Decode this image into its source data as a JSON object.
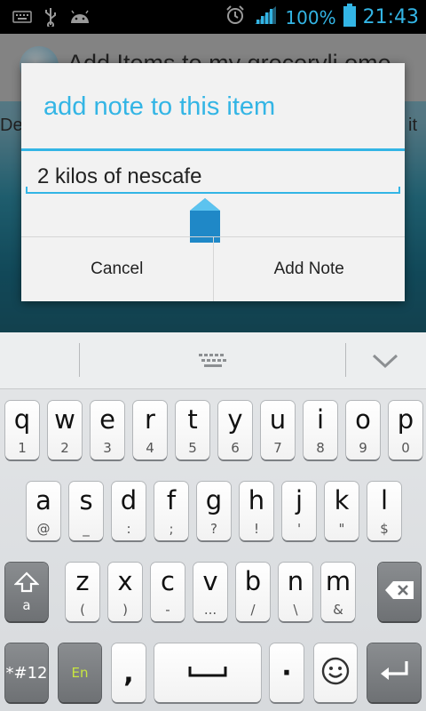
{
  "status_bar": {
    "battery_percent": "100%",
    "time": "21:43"
  },
  "background_app": {
    "title": "Add Items to my groceryli ome",
    "left_label_fragment": "De",
    "right_label_fragment": "it"
  },
  "dialog": {
    "title": "add note to this item",
    "input_value": "2 kilos of nescafe",
    "cancel_label": "Cancel",
    "add_note_label": "Add Note"
  },
  "keyboard": {
    "row1": [
      {
        "main": "q",
        "sub": "1"
      },
      {
        "main": "w",
        "sub": "2"
      },
      {
        "main": "e",
        "sub": "3"
      },
      {
        "main": "r",
        "sub": "4"
      },
      {
        "main": "t",
        "sub": "5"
      },
      {
        "main": "y",
        "sub": "6"
      },
      {
        "main": "u",
        "sub": "7"
      },
      {
        "main": "i",
        "sub": "8"
      },
      {
        "main": "o",
        "sub": "9"
      },
      {
        "main": "p",
        "sub": "0"
      }
    ],
    "row2": [
      {
        "main": "a",
        "sub": "@"
      },
      {
        "main": "s",
        "sub": "_"
      },
      {
        "main": "d",
        "sub": ":"
      },
      {
        "main": "f",
        "sub": ";"
      },
      {
        "main": "g",
        "sub": "?"
      },
      {
        "main": "h",
        "sub": "!"
      },
      {
        "main": "j",
        "sub": "'"
      },
      {
        "main": "k",
        "sub": "\""
      },
      {
        "main": "l",
        "sub": "$"
      }
    ],
    "row3": [
      {
        "main": "z",
        "sub": "("
      },
      {
        "main": "x",
        "sub": ")"
      },
      {
        "main": "c",
        "sub": "-"
      },
      {
        "main": "v",
        "sub": "..."
      },
      {
        "main": "b",
        "sub": "/"
      },
      {
        "main": "n",
        "sub": "\\"
      },
      {
        "main": "m",
        "sub": "&"
      }
    ],
    "shift_sub": "a",
    "symbols_label": "*#12",
    "language_label": "En",
    "comma_label": ",",
    "period_label": "·",
    "icons": [
      "keyboard-layout-icon",
      "chevron-down-icon",
      "shift-icon",
      "backspace-icon",
      "space-icon",
      "smiley-icon",
      "enter-icon"
    ],
    "accent_color": "#33b5e5"
  }
}
